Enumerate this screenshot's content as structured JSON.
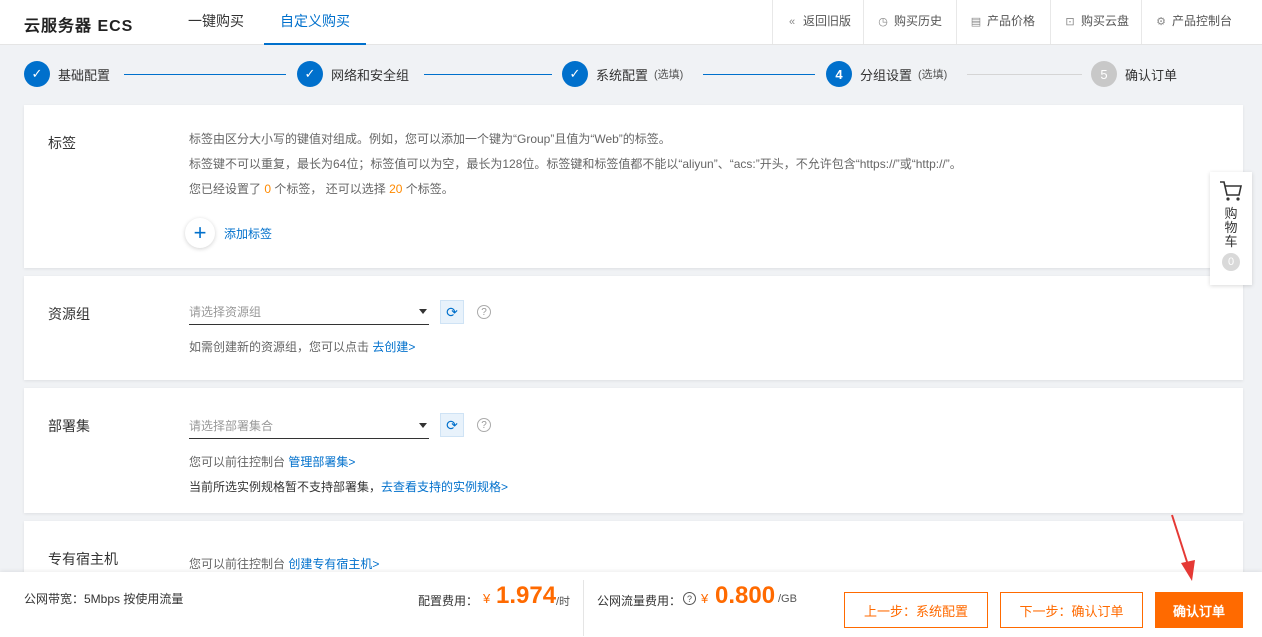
{
  "header": {
    "brand": "云服务器 ECS",
    "tabs": [
      "一键购买",
      "自定义购买"
    ],
    "nav": [
      {
        "icon": "double-left-icon",
        "label": "返回旧版"
      },
      {
        "icon": "clock-icon",
        "label": "购买历史"
      },
      {
        "icon": "list-icon",
        "label": "产品价格"
      },
      {
        "icon": "disk-icon",
        "label": "购买云盘"
      },
      {
        "icon": "gear-icon",
        "label": "产品控制台"
      }
    ]
  },
  "steps": [
    {
      "num": "1",
      "label": "基础配置",
      "optional": "",
      "state": "done"
    },
    {
      "num": "2",
      "label": "网络和安全组",
      "optional": "",
      "state": "done"
    },
    {
      "num": "3",
      "label": "系统配置",
      "optional": "(选填)",
      "state": "done"
    },
    {
      "num": "4",
      "label": "分组设置",
      "optional": "(选填)",
      "state": "current"
    },
    {
      "num": "5",
      "label": "确认订单",
      "optional": "",
      "state": "todo"
    }
  ],
  "tags": {
    "label": "标签",
    "line1": "标签由区分大小写的键值对组成。例如，您可以添加一个键为“Group”且值为“Web”的标签。",
    "line2": "标签键不可以重复，最长为64位；标签值可以为空，最长为128位。标签键和标签值都不能以“aliyun”、“acs:”开头，不允许包含“https://”或“http://”。",
    "line3_a": "您已经设置了",
    "line3_count": "0",
    "line3_b": "个标签，  还可以选择",
    "line3_max": "20",
    "line3_c": "个标签。",
    "add_label": "添加标签"
  },
  "resource_group": {
    "label": "资源组",
    "placeholder": "请选择资源组",
    "hint": "如需创建新的资源组，您可以点击",
    "hint_link": "去创建>"
  },
  "deployment_set": {
    "label": "部署集",
    "placeholder": "请选择部署集合",
    "hint1": "您可以前往控制台",
    "hint1_link": "管理部署集>",
    "hint2": "当前所选实例规格暂不支持部署集，",
    "hint2_link": "去查看支持的实例规格>"
  },
  "dedicated_host": {
    "label": "专有宿主机",
    "hint": "您可以前往控制台",
    "hint_link": "创建专有宿主机>"
  },
  "cart": {
    "label": "购物车",
    "count": "0"
  },
  "footer": {
    "bandwidth": "公网带宽：5Mbps 按使用流量",
    "config_fee_label": "配置费用：",
    "config_currency": "¥",
    "config_fee": "1.974",
    "config_unit": "/时",
    "traffic_fee_label": "公网流量费用：",
    "traffic_currency": "¥",
    "traffic_fee": "0.800",
    "traffic_unit": "/GB",
    "prev_button": "上一步：系统配置",
    "next_button": "下一步：确认订单",
    "confirm_button": "确认订单"
  },
  "colors": {
    "primary": "#0070cc",
    "accent": "#ff6a00",
    "annotation_arrow": "#e53935"
  }
}
